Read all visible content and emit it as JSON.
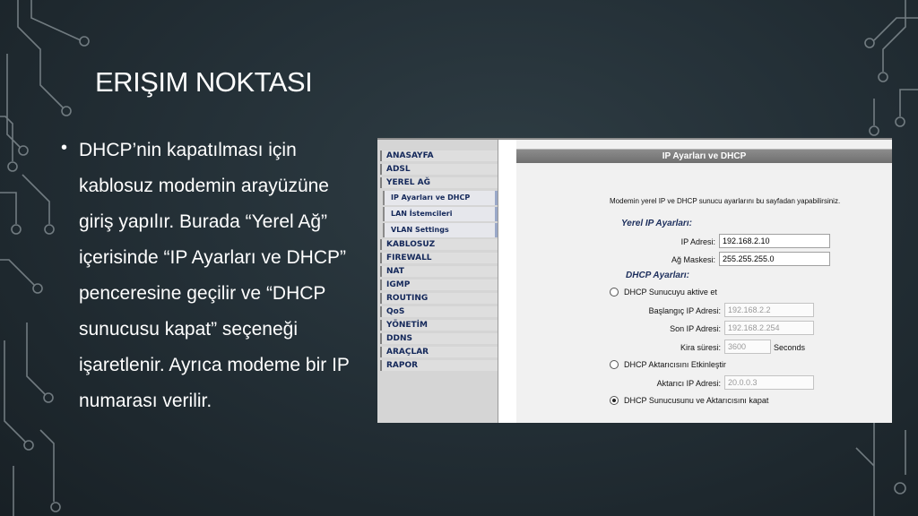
{
  "slide": {
    "title": "ERIŞIM NOKTASI",
    "bullet": "DHCP’nin kapatılması için kablosuz modemin arayüzüne giriş yapılır. Burada “Yerel Ağ” içerisinde “IP Ayarları ve DHCP” penceresine geçilir ve “DHCP sunucusu kapat” seçeneği işaretlenir. Ayrıca modeme bir IP numarası verilir."
  },
  "router": {
    "menu": {
      "items": [
        {
          "label": "ANASAYFA"
        },
        {
          "label": "ADSL"
        },
        {
          "label": "YEREL AĞ"
        }
      ],
      "subitems": [
        {
          "label": "IP Ayarları ve DHCP"
        },
        {
          "label": "LAN İstemcileri"
        },
        {
          "label": "VLAN Settings"
        }
      ],
      "items_after": [
        {
          "label": "KABLOSUZ"
        },
        {
          "label": "FIREWALL"
        },
        {
          "label": "NAT"
        },
        {
          "label": "IGMP"
        },
        {
          "label": "ROUTING"
        },
        {
          "label": "QoS"
        },
        {
          "label": "YÖNETİM"
        },
        {
          "label": "DDNS"
        },
        {
          "label": "ARAÇLAR"
        },
        {
          "label": "RAPOR"
        }
      ]
    },
    "header": "IP Ayarları ve DHCP",
    "intro": "Modemin yerel IP ve DHCP sunucu ayarlarını bu sayfadan yapabilirsiniz.",
    "local_ip": {
      "section": "Yerel IP Ayarları:",
      "ip_label": "IP Adresi:",
      "ip_value": "192.168.2.10",
      "mask_label": "Ağ Maskesi:",
      "mask_value": "255.255.255.0"
    },
    "dhcp": {
      "section": "DHCP Ayarları:",
      "enable_label": "DHCP Sunucuyu aktive et",
      "start_label": "Başlangıç IP Adresi:",
      "start_value": "192.168.2.2",
      "end_label": "Son IP Adresi:",
      "end_value": "192.168.2.254",
      "lease_label": "Kira süresi:",
      "lease_value": "3600",
      "lease_unit": "Seconds",
      "relay_label": "DHCP Aktarıcısını Etkinleştir",
      "relay_ip_label": "Aktarıcı IP Adresi:",
      "relay_ip_value": "20.0.0.3",
      "disable_label": "DHCP Sunucusunu ve Aktarıcısını kapat"
    }
  }
}
